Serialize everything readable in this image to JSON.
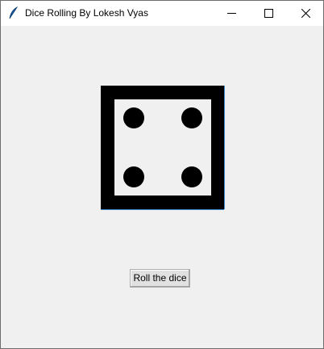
{
  "window": {
    "title": "Dice Rolling By Lokesh Vyas"
  },
  "titlebar": {
    "app_icon": "feather-icon",
    "minimize_icon": "minimize-icon",
    "maximize_icon": "maximize-icon",
    "close_icon": "close-icon"
  },
  "dice": {
    "face_value": 4,
    "pip_color": "#000000",
    "frame_color": "#000000"
  },
  "actions": {
    "roll_label": "Roll the dice"
  }
}
